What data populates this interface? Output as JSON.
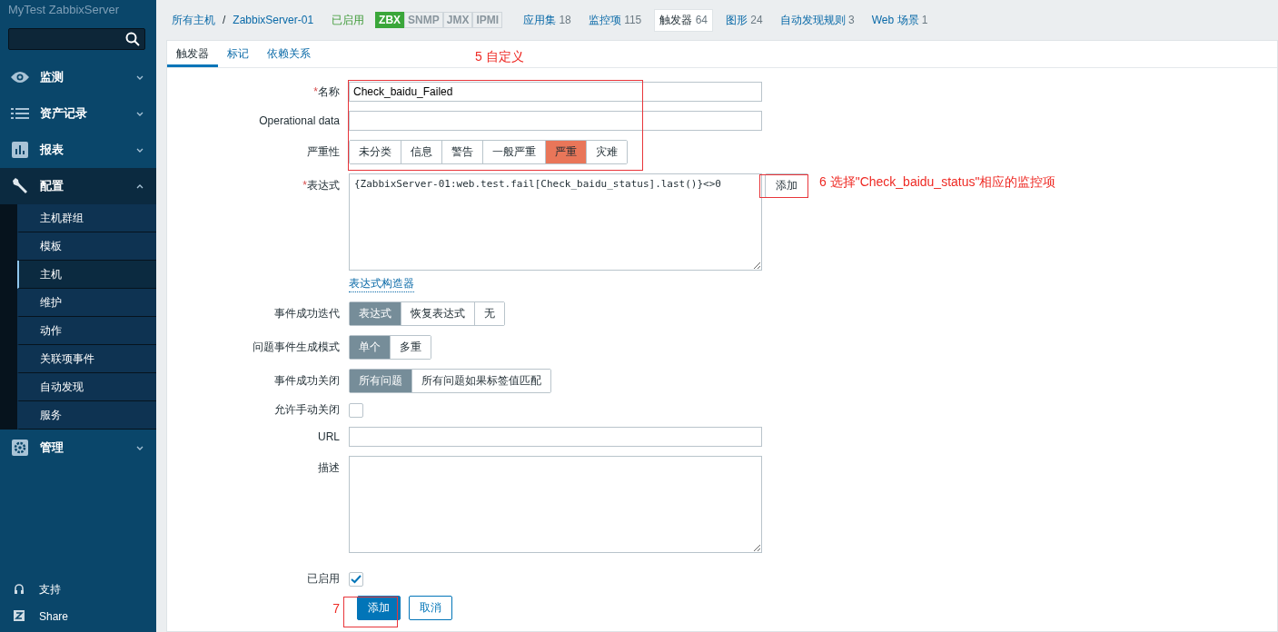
{
  "sidebar": {
    "logo": "MyTest ZabbixServer",
    "menu": [
      {
        "label": "监测",
        "expanded": false
      },
      {
        "label": "资产记录",
        "expanded": false
      },
      {
        "label": "报表",
        "expanded": false
      },
      {
        "label": "配置",
        "expanded": true,
        "children": [
          {
            "label": "主机群组",
            "selected": false
          },
          {
            "label": "模板",
            "selected": false
          },
          {
            "label": "主机",
            "selected": true
          },
          {
            "label": "维护",
            "selected": false
          },
          {
            "label": "动作",
            "selected": false
          },
          {
            "label": "关联项事件",
            "selected": false
          },
          {
            "label": "自动发现",
            "selected": false
          },
          {
            "label": "服务",
            "selected": false
          }
        ]
      },
      {
        "label": "管理",
        "expanded": false
      }
    ],
    "bottom": [
      {
        "label": "支持"
      },
      {
        "label": "Share"
      }
    ]
  },
  "host_nav": {
    "breadcrumb": [
      "所有主机",
      "ZabbixServer-01"
    ],
    "separator": "/",
    "status": "已启用",
    "availability": [
      {
        "label": "ZBX",
        "on": true
      },
      {
        "label": "SNMP",
        "on": false
      },
      {
        "label": "JMX",
        "on": false
      },
      {
        "label": "IPMI",
        "on": false
      }
    ],
    "tabs": [
      {
        "label": "应用集",
        "count": "18",
        "selected": false
      },
      {
        "label": "监控项",
        "count": "115",
        "selected": false
      },
      {
        "label": "触发器",
        "count": "64",
        "selected": true
      },
      {
        "label": "图形",
        "count": "24",
        "selected": false
      },
      {
        "label": "自动发现规则",
        "count": "3",
        "selected": false
      },
      {
        "label": "Web 场景",
        "count": "1",
        "selected": false
      }
    ]
  },
  "form_tabs": [
    {
      "label": "触发器",
      "selected": true
    },
    {
      "label": "标记",
      "selected": false
    },
    {
      "label": "依赖关系",
      "selected": false
    }
  ],
  "form": {
    "required_mark": "*",
    "name": {
      "label": "名称",
      "required": true,
      "value": "Check_baidu_Failed"
    },
    "operational_data": {
      "label": "Operational data"
    },
    "severity": {
      "label": "严重性",
      "options": [
        {
          "label": "未分类",
          "selected": false
        },
        {
          "label": "信息",
          "selected": false
        },
        {
          "label": "警告",
          "selected": false
        },
        {
          "label": "一般严重",
          "selected": false
        },
        {
          "label": "严重",
          "selected": true
        },
        {
          "label": "灾难",
          "selected": false
        }
      ]
    },
    "expression": {
      "label": "表达式",
      "required": true,
      "value": "{ZabbixServer-01:web.test.fail[Check_baidu_status].last()}<>0",
      "add_button": "添加",
      "builder_link": "表达式构造器"
    },
    "recovery": {
      "label": "事件成功迭代",
      "options": [
        {
          "label": "表达式",
          "selected": true
        },
        {
          "label": "恢复表达式",
          "selected": false
        },
        {
          "label": "无",
          "selected": false
        }
      ]
    },
    "problem_mode": {
      "label": "问题事件生成模式",
      "options": [
        {
          "label": "单个",
          "selected": true
        },
        {
          "label": "多重",
          "selected": false
        }
      ]
    },
    "ok_close": {
      "label": "事件成功关闭",
      "options": [
        {
          "label": "所有问题",
          "selected": true
        },
        {
          "label": "所有问题如果标签值匹配",
          "selected": false
        }
      ]
    },
    "manual_close": {
      "label": "允许手动关闭",
      "checked": false
    },
    "url": {
      "label": "URL"
    },
    "description": {
      "label": "描述"
    },
    "enabled": {
      "label": "已启用",
      "checked": true
    },
    "buttons": [
      {
        "label": "添加",
        "primary": true
      },
      {
        "label": "取消",
        "primary": false
      }
    ]
  },
  "annotations": [
    {
      "text": "5 自定义"
    },
    {
      "text": "6 选择\"Check_baidu_status\"相应的监控项"
    },
    {
      "text": "7"
    }
  ]
}
